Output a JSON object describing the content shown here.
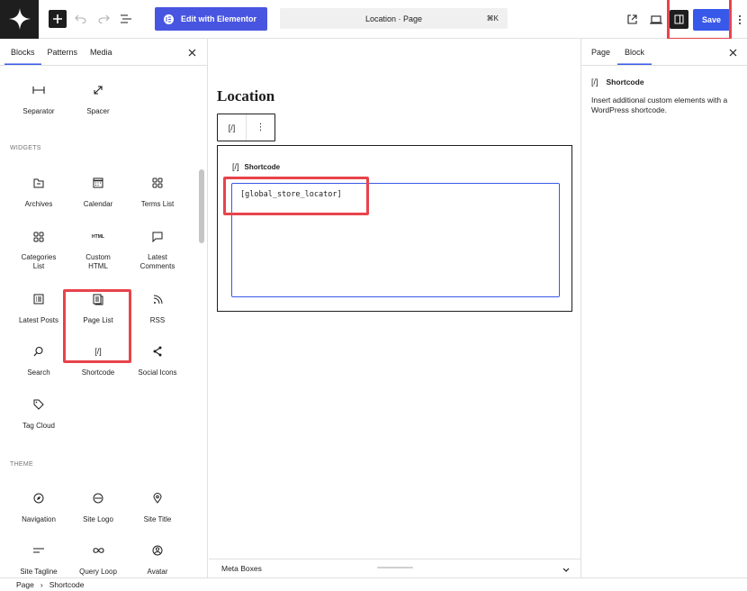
{
  "toolbar": {
    "elementor_label": "Edit with Elementor",
    "command_title": "Location · Page",
    "command_shortcut": "⌘K",
    "save_label": "Save"
  },
  "left_panel": {
    "tabs": [
      "Blocks",
      "Patterns",
      "Media"
    ],
    "top_blocks": [
      {
        "label": "Separator",
        "icon": "separator-icon"
      },
      {
        "label": "Spacer",
        "icon": "spacer-icon"
      }
    ],
    "sections": {
      "widgets": "WIDGETS",
      "theme": "THEME"
    },
    "widget_blocks": [
      {
        "label": "Archives",
        "icon": "archives-icon"
      },
      {
        "label": "Calendar",
        "icon": "calendar-icon"
      },
      {
        "label": "Terms List",
        "icon": "terms-list-icon"
      },
      {
        "label": "Categories List",
        "icon": "categories-icon"
      },
      {
        "label": "Custom HTML",
        "icon": "html-icon",
        "icon_text": "HTML"
      },
      {
        "label": "Latest Comments",
        "icon": "comments-icon"
      },
      {
        "label": "Latest Posts",
        "icon": "latest-posts-icon"
      },
      {
        "label": "Page List",
        "icon": "page-list-icon"
      },
      {
        "label": "RSS",
        "icon": "rss-icon"
      },
      {
        "label": "Search",
        "icon": "search-icon"
      },
      {
        "label": "Shortcode",
        "icon": "shortcode-icon",
        "icon_text": "[/]"
      },
      {
        "label": "Social Icons",
        "icon": "share-icon"
      },
      {
        "label": "Tag Cloud",
        "icon": "tag-icon"
      }
    ],
    "theme_blocks": [
      {
        "label": "Navigation",
        "icon": "navigation-icon"
      },
      {
        "label": "Site Logo",
        "icon": "site-logo-icon"
      },
      {
        "label": "Site Title",
        "icon": "site-title-icon"
      },
      {
        "label": "Site Tagline",
        "icon": "site-tagline-icon"
      },
      {
        "label": "Query Loop",
        "icon": "query-loop-icon"
      },
      {
        "label": "Avatar",
        "icon": "avatar-icon"
      }
    ]
  },
  "canvas": {
    "title": "Location",
    "block_toolbar_icon": "[/]",
    "block_toolbar_more": "⋮",
    "shortcode_icon": "[/]",
    "shortcode_title": "Shortcode",
    "shortcode_value": "[global_store_locator]",
    "metabox_label": "Meta Boxes"
  },
  "right_panel": {
    "tabs": [
      "Page",
      "Block"
    ],
    "block_icon": "[/]",
    "block_name": "Shortcode",
    "block_description": "Insert additional custom elements with a WordPress shortcode."
  },
  "breadcrumb": {
    "items": [
      "Page",
      "Shortcode"
    ],
    "separator": "›"
  },
  "colors": {
    "accent": "#3858e9",
    "elementor": "#4855e0",
    "highlight": "#e8434b",
    "dark": "#1e1e1e"
  }
}
